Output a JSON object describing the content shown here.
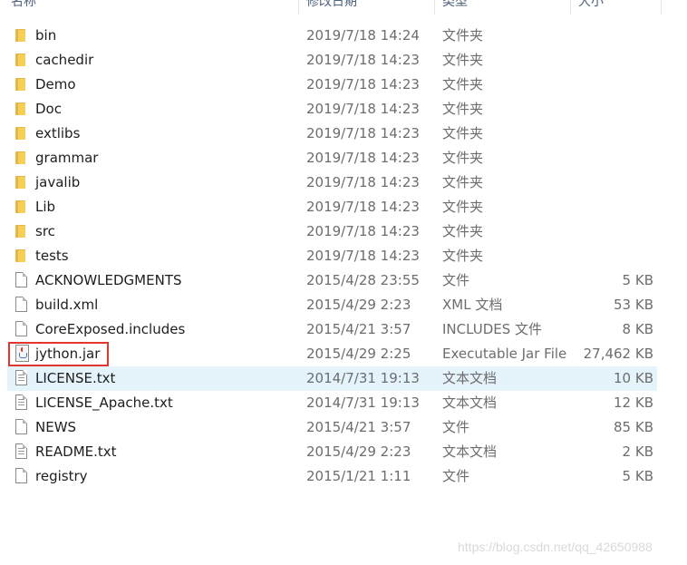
{
  "columns": {
    "name": "名称",
    "date": "修改日期",
    "type": "类型",
    "size": "大小"
  },
  "files": [
    {
      "name": "bin",
      "date": "2019/7/18 14:24",
      "type": "文件夹",
      "size": "",
      "icon": "folder-icon"
    },
    {
      "name": "cachedir",
      "date": "2019/7/18 14:23",
      "type": "文件夹",
      "size": "",
      "icon": "folder-icon"
    },
    {
      "name": "Demo",
      "date": "2019/7/18 14:23",
      "type": "文件夹",
      "size": "",
      "icon": "folder-icon"
    },
    {
      "name": "Doc",
      "date": "2019/7/18 14:23",
      "type": "文件夹",
      "size": "",
      "icon": "folder-icon"
    },
    {
      "name": "extlibs",
      "date": "2019/7/18 14:23",
      "type": "文件夹",
      "size": "",
      "icon": "folder-icon"
    },
    {
      "name": "grammar",
      "date": "2019/7/18 14:23",
      "type": "文件夹",
      "size": "",
      "icon": "folder-icon"
    },
    {
      "name": "javalib",
      "date": "2019/7/18 14:23",
      "type": "文件夹",
      "size": "",
      "icon": "folder-icon"
    },
    {
      "name": "Lib",
      "date": "2019/7/18 14:23",
      "type": "文件夹",
      "size": "",
      "icon": "folder-icon"
    },
    {
      "name": "src",
      "date": "2019/7/18 14:23",
      "type": "文件夹",
      "size": "",
      "icon": "folder-icon"
    },
    {
      "name": "tests",
      "date": "2019/7/18 14:23",
      "type": "文件夹",
      "size": "",
      "icon": "folder-icon"
    },
    {
      "name": "ACKNOWLEDGMENTS",
      "date": "2015/4/28 23:55",
      "type": "文件",
      "size": "5 KB",
      "icon": "document-icon"
    },
    {
      "name": "build.xml",
      "date": "2015/4/29 2:23",
      "type": "XML 文档",
      "size": "53 KB",
      "icon": "document-icon"
    },
    {
      "name": "CoreExposed.includes",
      "date": "2015/4/21 3:57",
      "type": "INCLUDES 文件",
      "size": "8 KB",
      "icon": "document-icon"
    },
    {
      "name": "jython.jar",
      "date": "2015/4/29 2:25",
      "type": "Executable Jar File",
      "size": "27,462 KB",
      "icon": "java-jar-icon",
      "highlighted": true
    },
    {
      "name": "LICENSE.txt",
      "date": "2014/7/31 19:13",
      "type": "文本文档",
      "size": "10 KB",
      "icon": "text-document-icon",
      "selected": true
    },
    {
      "name": "LICENSE_Apache.txt",
      "date": "2014/7/31 19:13",
      "type": "文本文档",
      "size": "12 KB",
      "icon": "text-document-icon"
    },
    {
      "name": "NEWS",
      "date": "2015/4/21 3:57",
      "type": "文件",
      "size": "85 KB",
      "icon": "document-icon"
    },
    {
      "name": "README.txt",
      "date": "2015/4/29 2:23",
      "type": "文本文档",
      "size": "2 KB",
      "icon": "text-document-icon"
    },
    {
      "name": "registry",
      "date": "2015/1/21 1:11",
      "type": "文件",
      "size": "5 KB",
      "icon": "document-icon"
    }
  ],
  "watermark": "https://blog.csdn.net/qq_42650988",
  "colors": {
    "selection": "#e5f3fb",
    "highlight_box": "#e0362f",
    "folder": "#f6cf57"
  }
}
